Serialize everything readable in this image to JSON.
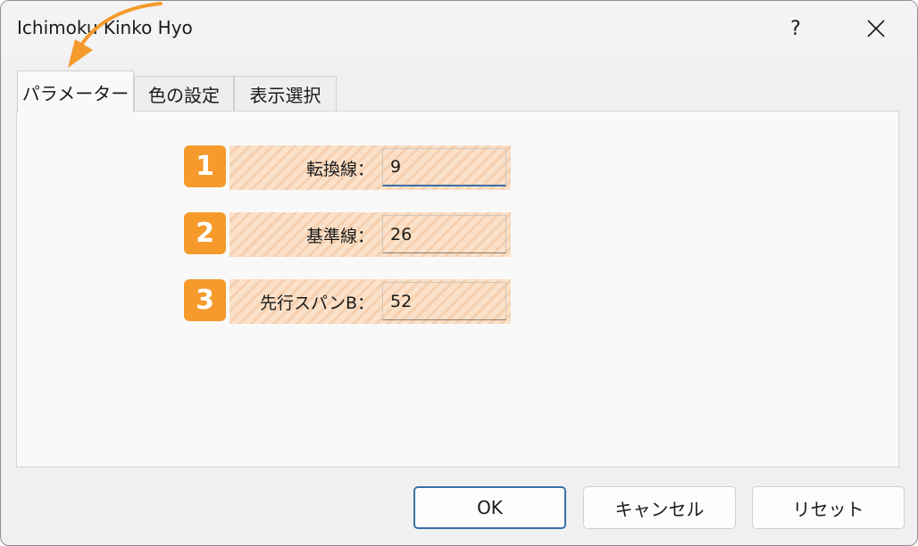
{
  "window": {
    "title": "Ichimoku Kinko Hyo",
    "help_label": "?",
    "close_icon": "close-icon"
  },
  "tabs": [
    {
      "label": "パラメーター",
      "active": true
    },
    {
      "label": "色の設定",
      "active": false
    },
    {
      "label": "表示選択",
      "active": false
    }
  ],
  "params": [
    {
      "badge": "1",
      "label": "転換線：",
      "value": "9"
    },
    {
      "badge": "2",
      "label": "基準線：",
      "value": "26"
    },
    {
      "badge": "3",
      "label": "先行スパンB：",
      "value": "52"
    }
  ],
  "buttons": {
    "ok": "OK",
    "cancel": "キャンセル",
    "reset": "リセット"
  },
  "colors": {
    "badge": "#f59a2b",
    "annotation_arrow": "#f59a2b",
    "focus_accent": "#3a6fa8"
  }
}
